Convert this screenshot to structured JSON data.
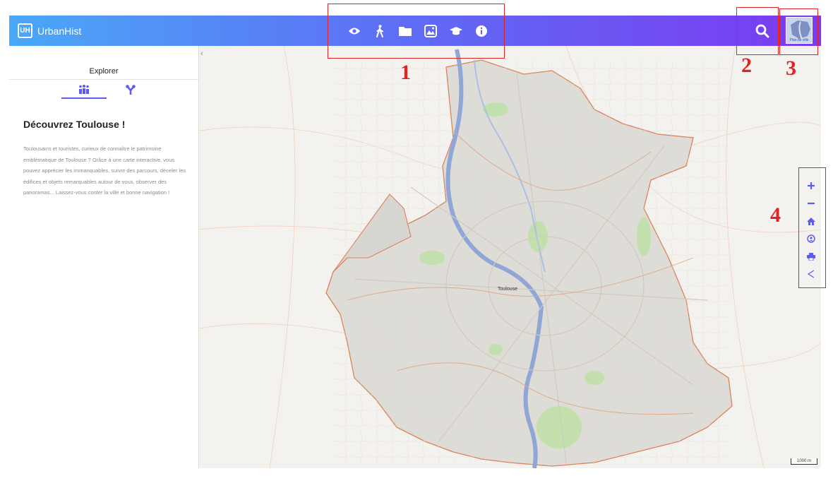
{
  "header": {
    "app_name": "UrbanHist",
    "logo_text": "UH",
    "nav_icons": [
      "eye-icon",
      "pedestrian-icon",
      "folder-icon",
      "panorama-icon",
      "graduation-cap-icon",
      "info-icon"
    ],
    "search_icon": "search-icon",
    "plan_label": "Plan de ville"
  },
  "sidebar": {
    "title": "Explorer",
    "tabs": [
      "people-icon",
      "network-icon"
    ],
    "heading": "Découvrez Toulouse !",
    "description": "Toulousains et touristes, curieux de connaître le patrimoine emblématique de Toulouse ? Grâce à une carte interactive, vous pouvez apprécier les immanquables, suivre des parcours, déceler les édifices et objets remarquables autour de vous, observer des panoramas... Laissez-vous conter la ville et bonne navigation !"
  },
  "map": {
    "city_label": "Toulouse",
    "scale_label": "1000 m",
    "tools": [
      "zoom-in-icon",
      "zoom-out-icon",
      "home-icon",
      "locate-icon",
      "print-icon",
      "share-icon"
    ]
  },
  "annotations": [
    "1",
    "2",
    "3",
    "4"
  ],
  "colors": {
    "header_start": "#4aa8f7",
    "header_end": "#7b3af0",
    "accent": "#5b5cf0",
    "annotation": "#e02424",
    "river": "#8fa6d6",
    "boundary": "#d9825a"
  }
}
